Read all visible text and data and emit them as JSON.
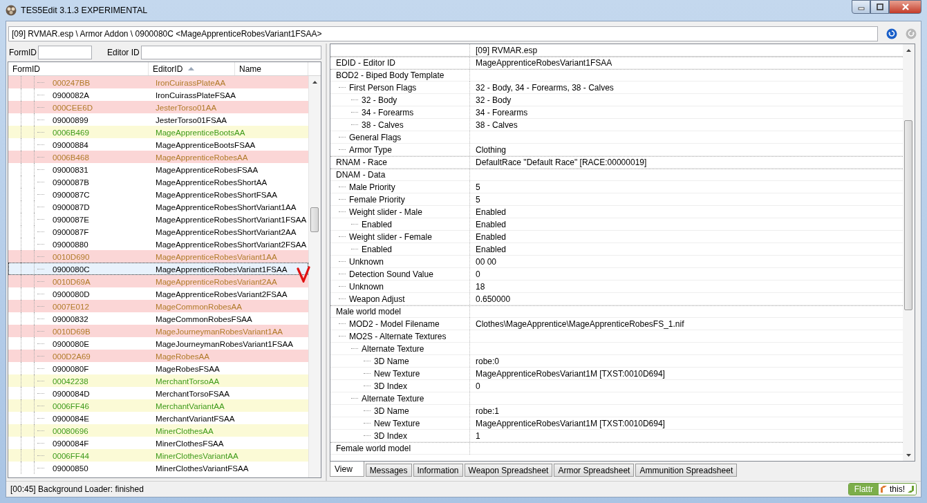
{
  "window": {
    "title": "TES5Edit 3.1.3 EXPERIMENTAL"
  },
  "path": {
    "value": "[09] RVMAR.esp \\ Armor Addon \\ 0900080C <MageApprenticeRobesVariant1FSAA>"
  },
  "filters": [
    {
      "label": "FormID"
    },
    {
      "label": "Editor ID"
    }
  ],
  "record_list": {
    "columns": [
      "FormID",
      "EditorID",
      "Name"
    ],
    "rows": [
      {
        "form_id": "000247BB",
        "editor_id": "IronCuirassPlateAA",
        "kind": "conflict",
        "selected": false
      },
      {
        "form_id": "0900082A",
        "editor_id": "IronCuirassPlateFSAA",
        "kind": "normal",
        "selected": false
      },
      {
        "form_id": "000CEE6D",
        "editor_id": "JesterTorso01AA",
        "kind": "conflict",
        "selected": false
      },
      {
        "form_id": "09000899",
        "editor_id": "JesterTorso01FSAA",
        "kind": "normal",
        "selected": false
      },
      {
        "form_id": "0006B469",
        "editor_id": "MageApprenticeBootsAA",
        "kind": "override",
        "selected": false
      },
      {
        "form_id": "09000884",
        "editor_id": "MageApprenticeBootsFSAA",
        "kind": "normal",
        "selected": false
      },
      {
        "form_id": "0006B468",
        "editor_id": "MageApprenticeRobesAA",
        "kind": "conflict",
        "selected": false
      },
      {
        "form_id": "09000831",
        "editor_id": "MageApprenticeRobesFSAA",
        "kind": "normal",
        "selected": false
      },
      {
        "form_id": "0900087B",
        "editor_id": "MageApprenticeRobesShortAA",
        "kind": "normal",
        "selected": false
      },
      {
        "form_id": "0900087C",
        "editor_id": "MageApprenticeRobesShortFSAA",
        "kind": "normal",
        "selected": false
      },
      {
        "form_id": "0900087D",
        "editor_id": "MageApprenticeRobesShortVariant1AA",
        "kind": "normal",
        "selected": false
      },
      {
        "form_id": "0900087E",
        "editor_id": "MageApprenticeRobesShortVariant1FSAA",
        "kind": "normal",
        "selected": false
      },
      {
        "form_id": "0900087F",
        "editor_id": "MageApprenticeRobesShortVariant2AA",
        "kind": "normal",
        "selected": false
      },
      {
        "form_id": "09000880",
        "editor_id": "MageApprenticeRobesShortVariant2FSAA",
        "kind": "normal",
        "selected": false
      },
      {
        "form_id": "0010D690",
        "editor_id": "MageApprenticeRobesVariant1AA",
        "kind": "conflict",
        "selected": false
      },
      {
        "form_id": "0900080C",
        "editor_id": "MageApprenticeRobesVariant1FSAA",
        "kind": "normal",
        "selected": true
      },
      {
        "form_id": "0010D69A",
        "editor_id": "MageApprenticeRobesVariant2AA",
        "kind": "conflict",
        "selected": false
      },
      {
        "form_id": "0900080D",
        "editor_id": "MageApprenticeRobesVariant2FSAA",
        "kind": "normal",
        "selected": false
      },
      {
        "form_id": "0007E012",
        "editor_id": "MageCommonRobesAA",
        "kind": "conflict",
        "selected": false
      },
      {
        "form_id": "09000832",
        "editor_id": "MageCommonRobesFSAA",
        "kind": "normal",
        "selected": false
      },
      {
        "form_id": "0010D69B",
        "editor_id": "MageJourneymanRobesVariant1AA",
        "kind": "conflict",
        "selected": false
      },
      {
        "form_id": "0900080E",
        "editor_id": "MageJourneymanRobesVariant1FSAA",
        "kind": "normal",
        "selected": false
      },
      {
        "form_id": "000D2A69",
        "editor_id": "MageRobesAA",
        "kind": "conflict",
        "selected": false
      },
      {
        "form_id": "0900080F",
        "editor_id": "MageRobesFSAA",
        "kind": "normal",
        "selected": false
      },
      {
        "form_id": "00042238",
        "editor_id": "MerchantTorsoAA",
        "kind": "override",
        "selected": false
      },
      {
        "form_id": "0900084D",
        "editor_id": "MerchantTorsoFSAA",
        "kind": "normal",
        "selected": false
      },
      {
        "form_id": "0006FF46",
        "editor_id": "MerchantVariantAA",
        "kind": "override",
        "selected": false
      },
      {
        "form_id": "0900084E",
        "editor_id": "MerchantVariantFSAA",
        "kind": "normal",
        "selected": false
      },
      {
        "form_id": "00080696",
        "editor_id": "MinerClothesAA",
        "kind": "override",
        "selected": false
      },
      {
        "form_id": "0900084F",
        "editor_id": "MinerClothesFSAA",
        "kind": "normal",
        "selected": false
      },
      {
        "form_id": "0006FF44",
        "editor_id": "MinerClothesVariantAA",
        "kind": "override",
        "selected": false
      },
      {
        "form_id": "09000850",
        "editor_id": "MinerClothesVariantFSAA",
        "kind": "normal",
        "selected": false
      }
    ]
  },
  "record_view": {
    "header": "[09] RVMAR.esp",
    "fields": [
      {
        "label": "EDID - Editor ID",
        "value": "MageApprenticeRobesVariant1FSAA"
      },
      {
        "label": "BOD2 - Biped Body Template",
        "children": [
          {
            "label": "First Person Flags",
            "value": "32 - Body, 34 - Forearms, 38 - Calves",
            "children": [
              {
                "label": "32 - Body",
                "value": "32 - Body"
              },
              {
                "label": "34 - Forearms",
                "value": "34 - Forearms"
              },
              {
                "label": "38 - Calves",
                "value": "38 - Calves"
              }
            ]
          },
          {
            "label": "General Flags"
          },
          {
            "label": "Armor Type",
            "value": "Clothing"
          }
        ]
      },
      {
        "label": "RNAM - Race",
        "value": "DefaultRace \"Default Race\" [RACE:00000019]"
      },
      {
        "label": "DNAM - Data",
        "children": [
          {
            "label": "Male Priority",
            "value": "5"
          },
          {
            "label": "Female Priority",
            "value": "5"
          },
          {
            "label": "Weight slider - Male",
            "value": "Enabled",
            "children": [
              {
                "label": "Enabled",
                "value": "Enabled"
              }
            ]
          },
          {
            "label": "Weight slider - Female",
            "value": "Enabled",
            "children": [
              {
                "label": "Enabled",
                "value": "Enabled"
              }
            ]
          },
          {
            "label": "Unknown",
            "value": "00 00"
          },
          {
            "label": "Detection Sound Value",
            "value": "0"
          },
          {
            "label": "Unknown",
            "value": "18"
          },
          {
            "label": "Weapon Adjust",
            "value": "0.650000"
          }
        ]
      },
      {
        "label": "Male world model",
        "children": [
          {
            "label": "MOD2 - Model Filename",
            "value": "Clothes\\MageApprentice\\MageApprenticeRobesFS_1.nif"
          },
          {
            "label": "MO2S - Alternate Textures",
            "children": [
              {
                "label": "Alternate Texture",
                "children": [
                  {
                    "label": "3D Name",
                    "value": "robe:0"
                  },
                  {
                    "label": "New Texture",
                    "value": "MageApprenticeRobesVariant1M [TXST:0010D694]"
                  },
                  {
                    "label": "3D Index",
                    "value": "0"
                  }
                ]
              },
              {
                "label": "Alternate Texture",
                "children": [
                  {
                    "label": "3D Name",
                    "value": "robe:1"
                  },
                  {
                    "label": "New Texture",
                    "value": "MageApprenticeRobesVariant1M [TXST:0010D694]"
                  },
                  {
                    "label": "3D Index",
                    "value": "1"
                  }
                ]
              }
            ]
          }
        ]
      },
      {
        "label": "Female world model"
      }
    ]
  },
  "tabs": [
    {
      "label": "View",
      "selected": true
    },
    {
      "label": "Messages",
      "selected": false
    },
    {
      "label": "Information",
      "selected": false
    },
    {
      "label": "Weapon Spreadsheet",
      "selected": false
    },
    {
      "label": "Armor Spreadsheet",
      "selected": false
    },
    {
      "label": "Ammunition Spreadsheet",
      "selected": false
    }
  ],
  "status_bar": {
    "text": "[00:45] Background Loader: finished",
    "flattr": {
      "label": "Flattr",
      "action": "this!"
    }
  }
}
